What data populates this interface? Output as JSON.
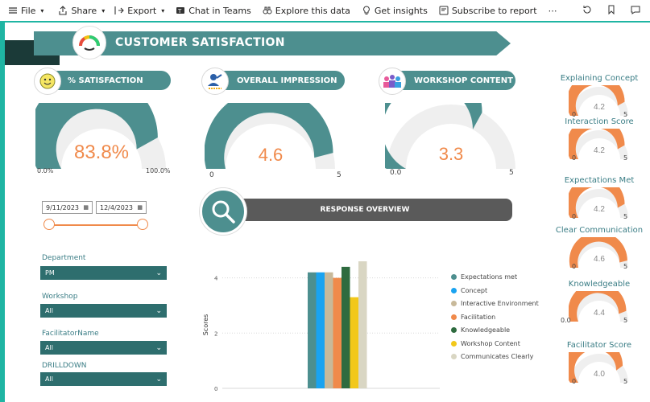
{
  "toolbar": {
    "file": "File",
    "share": "Share",
    "export": "Export",
    "chat": "Chat in Teams",
    "explore": "Explore this data",
    "insights": "Get insights",
    "subscribe": "Subscribe to report",
    "more": "⋯"
  },
  "header": {
    "title": "CUSTOMER SATISFACTION"
  },
  "cards": [
    {
      "title": "% SATISFACTION",
      "value": "83.8%",
      "min": "0.0%",
      "max": "100.0%",
      "fraction": 0.838,
      "icon": "smiley-icon"
    },
    {
      "title": "OVERALL IMPRESSION",
      "value": "4.6",
      "min": "0",
      "max": "5",
      "fraction": 0.92,
      "icon": "rating-person-icon"
    },
    {
      "title": "WORKSHOP CONTENT",
      "value": "3.3",
      "min": "0.0",
      "max": "5",
      "fraction": 0.66,
      "icon": "group-people-icon"
    }
  ],
  "side_gauges": [
    {
      "label": "Explaining Concept",
      "value": "4.2",
      "min": "0",
      "max": "5",
      "fraction": 0.84
    },
    {
      "label": "Interaction Score",
      "value": "4.2",
      "min": "0",
      "max": "5",
      "fraction": 0.84
    },
    {
      "label": "Expectations Met",
      "value": "4.2",
      "min": "0",
      "max": "5",
      "fraction": 0.84
    },
    {
      "label": "Clear Communication",
      "value": "4.6",
      "min": "0",
      "max": "5",
      "fraction": 0.92
    },
    {
      "label": "Knowledgeable",
      "value": "4.4",
      "min": "0.0",
      "max": "5",
      "fraction": 0.88
    },
    {
      "label": "Facilitator Score",
      "value": "4.0",
      "min": "0",
      "max": "5",
      "fraction": 0.8
    }
  ],
  "dates": {
    "start": "9/11/2023",
    "end": "12/4/2023"
  },
  "slicers": [
    {
      "label": "Department",
      "value": "PM"
    },
    {
      "label": "Workshop",
      "value": "All"
    },
    {
      "label": "FacilitatorName",
      "value": "All"
    },
    {
      "label": "DRILLDOWN",
      "value": "All"
    }
  ],
  "response": {
    "title": "RESPONSE OVERVIEW"
  },
  "chart_data": {
    "type": "bar",
    "ylabel": "Scores",
    "ylim": [
      0,
      4.6
    ],
    "yticks": [
      "0",
      "2",
      "4"
    ],
    "series": [
      {
        "name": "Expectations met",
        "value": 4.2,
        "color": "#4d8f8f"
      },
      {
        "name": "Concept",
        "value": 4.2,
        "color": "#1aa3f0"
      },
      {
        "name": "Interactive Environment",
        "value": 4.2,
        "color": "#c8b99a"
      },
      {
        "name": "Facilitation",
        "value": 4.0,
        "color": "#f08a4b"
      },
      {
        "name": "Knowledgeable",
        "value": 4.4,
        "color": "#2e6b3f"
      },
      {
        "name": "Workshop Content",
        "value": 3.3,
        "color": "#f2c81b"
      },
      {
        "name": "Communicates Clearly",
        "value": 4.6,
        "color": "#d9d6c3"
      }
    ]
  },
  "colors": {
    "accent": "#4d8f8f",
    "value": "#f08a4b",
    "track": "#efefef"
  }
}
